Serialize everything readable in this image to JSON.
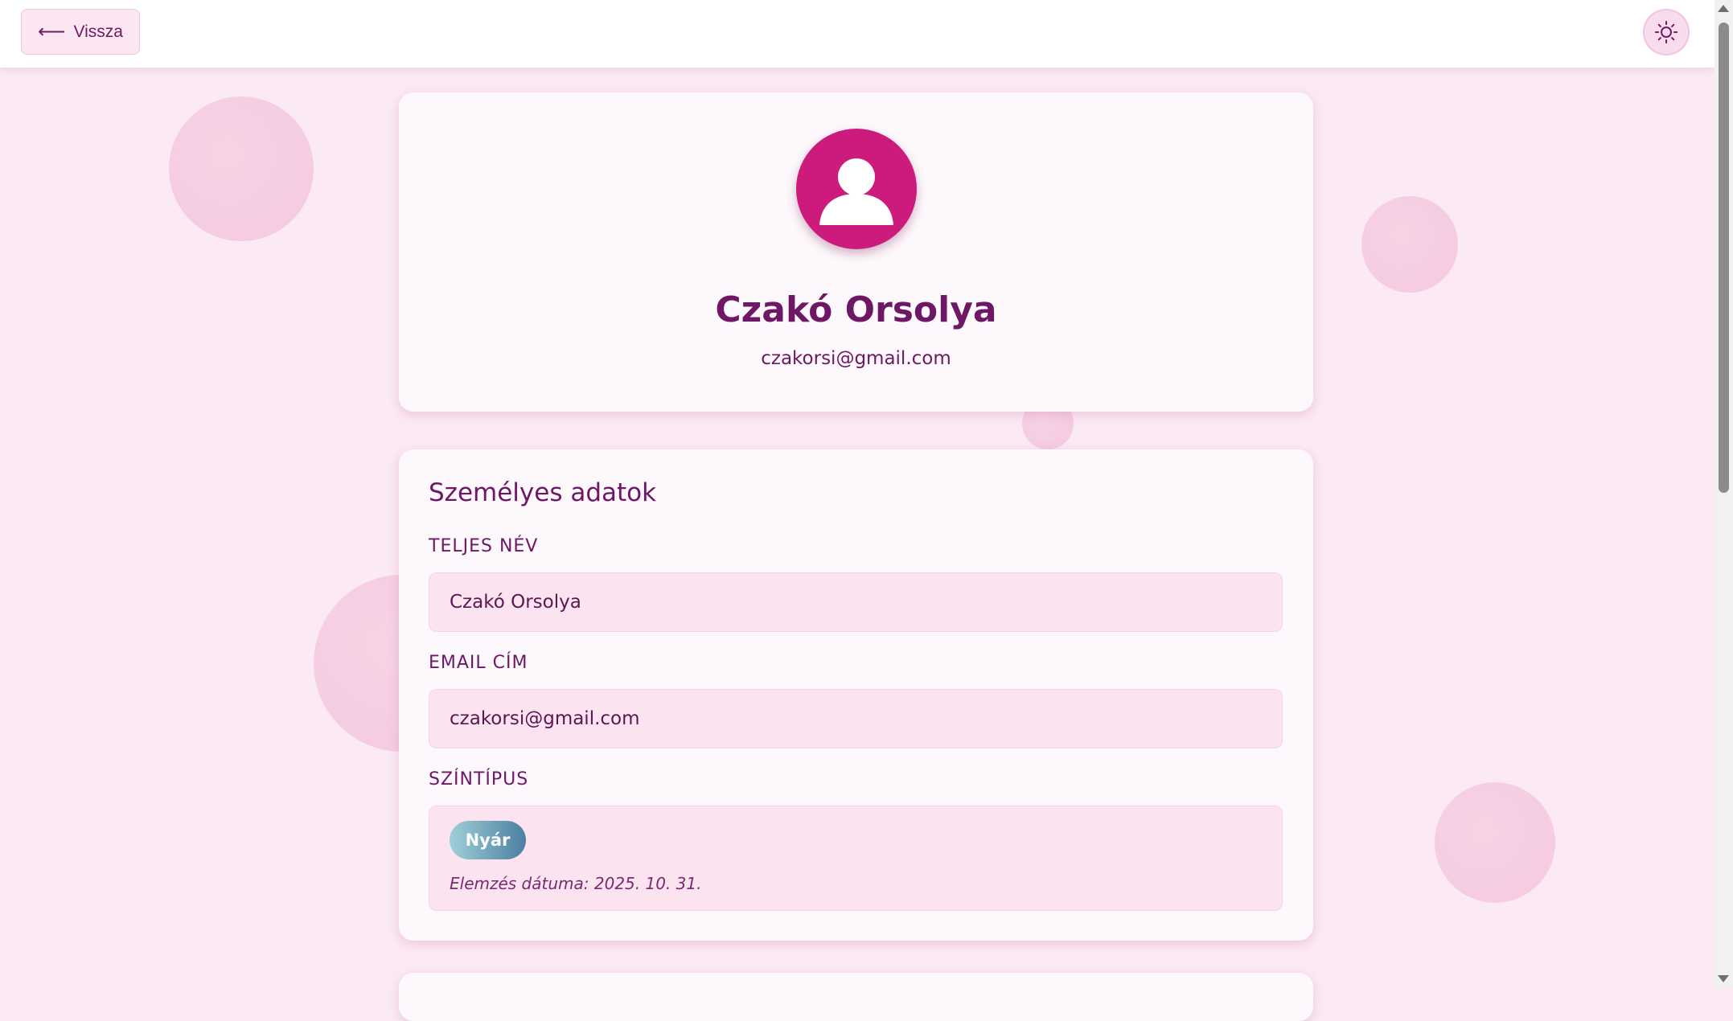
{
  "header": {
    "back_arrow": "⟵",
    "back_label": "Vissza",
    "theme_icon": "sun-icon"
  },
  "profile": {
    "avatar_icon": "user-avatar-icon",
    "name": "Czakó Orsolya",
    "email": "czakorsi@gmail.com"
  },
  "personal": {
    "title": "Személyes adatok",
    "fullname_label": "TELJES NÉV",
    "fullname_value": "Czakó Orsolya",
    "email_label": "EMAIL CÍM",
    "email_value": "czakorsi@gmail.com",
    "colortype_label": "SZÍNTÍPUS",
    "colortype_value": "Nyár",
    "analysis_date": "Elemzés dátuma: 2025. 10. 31."
  },
  "colors": {
    "accent": "#cc1a7d",
    "heading": "#6e1766",
    "background": "#fbeaf3",
    "badge_gradient_start": "#9fcfd8",
    "badge_gradient_end": "#4b7fa2"
  }
}
